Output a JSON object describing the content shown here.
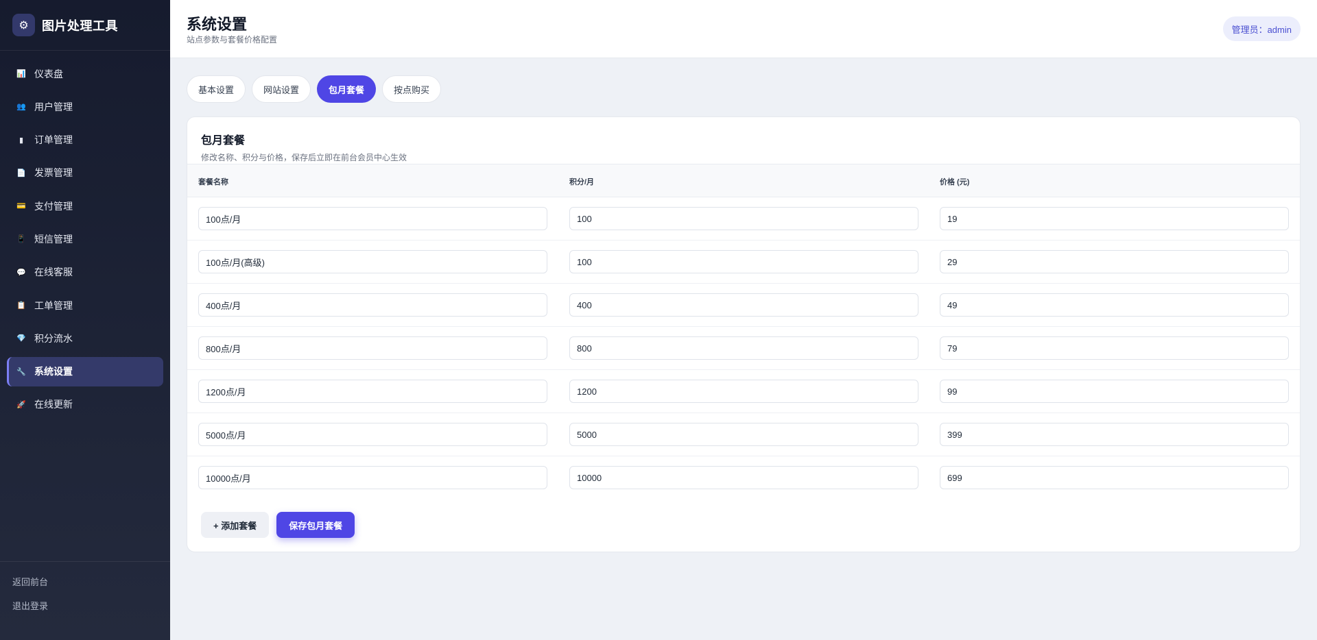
{
  "brand": {
    "logo_icon": "⚙",
    "title": "图片处理工具"
  },
  "sidebar": {
    "items": [
      {
        "label": "仪表盘",
        "icon": "📊",
        "icon_name": "dashboard-icon"
      },
      {
        "label": "用户管理",
        "icon": "👥",
        "icon_name": "users-icon"
      },
      {
        "label": "订单管理",
        "icon": "▮",
        "icon_name": "order-icon"
      },
      {
        "label": "发票管理",
        "icon": "📄",
        "icon_name": "invoice-icon"
      },
      {
        "label": "支付管理",
        "icon": "💳",
        "icon_name": "payment-icon"
      },
      {
        "label": "短信管理",
        "icon": "📱",
        "icon_name": "sms-icon"
      },
      {
        "label": "在线客服",
        "icon": "💬",
        "icon_name": "chat-icon"
      },
      {
        "label": "工单管理",
        "icon": "📋",
        "icon_name": "ticket-icon"
      },
      {
        "label": "积分流水",
        "icon": "💎",
        "icon_name": "points-icon"
      },
      {
        "label": "系统设置",
        "icon": "🔧",
        "icon_name": "settings-icon",
        "active": true
      },
      {
        "label": "在线更新",
        "icon": "🚀",
        "icon_name": "update-icon"
      }
    ],
    "footer": {
      "back_label": "返回前台",
      "logout_label": "退出登录"
    }
  },
  "header": {
    "title": "系统设置",
    "subtitle": "站点参数与套餐价格配置",
    "admin_label": "管理员：admin"
  },
  "tabs": [
    {
      "label": "基本设置",
      "active": false
    },
    {
      "label": "网站设置",
      "active": false
    },
    {
      "label": "包月套餐",
      "active": true
    },
    {
      "label": "按点购买",
      "active": false
    }
  ],
  "card": {
    "title": "包月套餐",
    "description": "修改名称、积分与价格，保存后立即在前台会员中心生效",
    "columns": [
      "套餐名称",
      "积分/月",
      "价格 (元)"
    ],
    "rows": [
      {
        "name": "100点/月",
        "points": "100",
        "price": "19"
      },
      {
        "name": "100点/月(高级)",
        "points": "100",
        "price": "29"
      },
      {
        "name": "400点/月",
        "points": "400",
        "price": "49"
      },
      {
        "name": "800点/月",
        "points": "800",
        "price": "79"
      },
      {
        "name": "1200点/月",
        "points": "1200",
        "price": "99"
      },
      {
        "name": "5000点/月",
        "points": "5000",
        "price": "399"
      },
      {
        "name": "10000点/月",
        "points": "10000",
        "price": "699"
      }
    ],
    "add_label": "+ 添加套餐",
    "save_label": "保存包月套餐"
  },
  "colors": {
    "accent": "#4f46e5",
    "sidebar_bg": "#1a1f33",
    "page_bg": "#eef1f6"
  }
}
